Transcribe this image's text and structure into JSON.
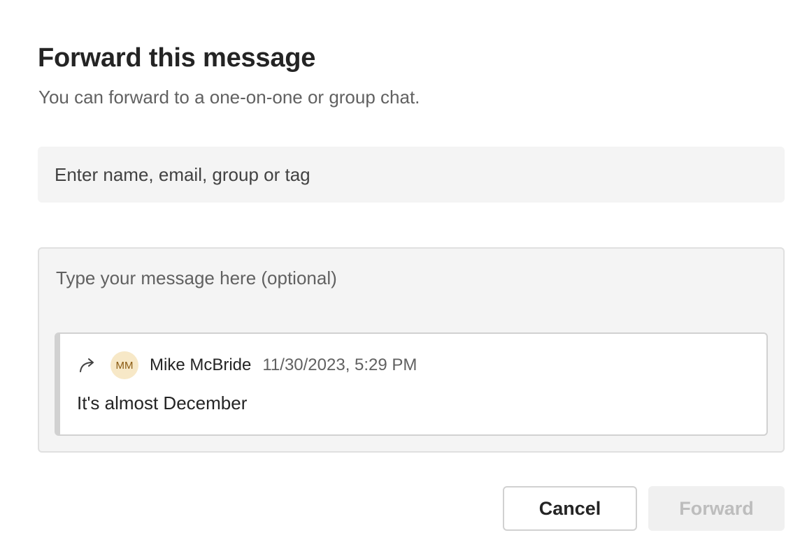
{
  "dialog": {
    "title": "Forward this message",
    "subtitle": "You can forward to a one-on-one or group chat."
  },
  "recipient": {
    "placeholder": "Enter name, email, group or tag",
    "value": ""
  },
  "compose": {
    "placeholder": "Type your message here (optional)",
    "value": ""
  },
  "quoted_message": {
    "icon": "forward-arrow-icon",
    "avatar_initials": "MM",
    "avatar_color": "#f7e8c7",
    "sender": "Mike McBride",
    "timestamp": "11/30/2023, 5:29 PM",
    "body": "It's almost December"
  },
  "actions": {
    "cancel_label": "Cancel",
    "forward_label": "Forward",
    "forward_enabled": false
  }
}
